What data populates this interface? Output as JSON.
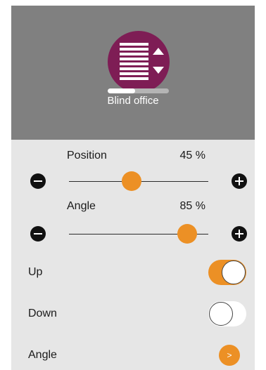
{
  "device": {
    "name": "Blind office",
    "icon": "window-blind-icon",
    "icon_color": "#7e1d55",
    "level_percent": 45
  },
  "position": {
    "label": "Position",
    "value_text": "45 %",
    "value": 45
  },
  "angle_slider": {
    "label": "Angle",
    "value_text": "85 %",
    "value": 85
  },
  "toggles": {
    "up": {
      "label": "Up",
      "state": "on"
    },
    "down": {
      "label": "Down",
      "state": "off"
    }
  },
  "angle_nav": {
    "label": "Angle",
    "button_text": ">"
  },
  "colors": {
    "header_bg": "#808080",
    "body_bg": "#e6e6e6",
    "accent": "#ec9025"
  }
}
